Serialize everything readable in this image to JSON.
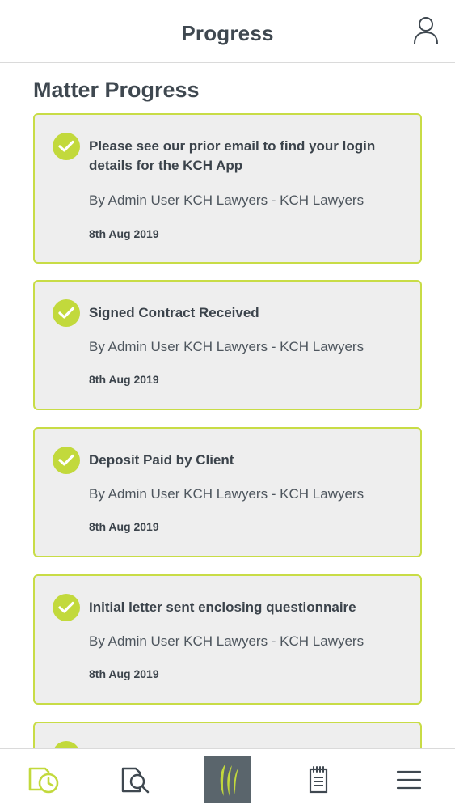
{
  "header": {
    "title": "Progress",
    "profile_icon": "user-icon"
  },
  "main": {
    "section_title": "Matter Progress",
    "items": [
      {
        "title_lines": [
          "Please see our prior email to find your login",
          "details for the KCH App"
        ],
        "author": "By Admin User KCH Lawyers - KCH Lawyers",
        "date": "8th Aug 2019",
        "status_icon": "check-circle-icon"
      },
      {
        "title_lines": [
          "Signed Contract Received"
        ],
        "author": "By Admin User KCH Lawyers - KCH Lawyers",
        "date": "8th Aug 2019",
        "status_icon": "check-circle-icon"
      },
      {
        "title_lines": [
          "Deposit Paid by Client"
        ],
        "author": "By Admin User KCH Lawyers - KCH Lawyers",
        "date": "8th Aug 2019",
        "status_icon": "check-circle-icon"
      },
      {
        "title_lines": [
          "Initial letter sent enclosing questionnaire"
        ],
        "author": "By Admin User KCH Lawyers - KCH Lawyers",
        "date": "8th Aug 2019",
        "status_icon": "check-circle-icon"
      }
    ]
  },
  "bottom_nav": {
    "items": [
      {
        "icon": "progress-clock-icon",
        "active": true
      },
      {
        "icon": "document-search-icon",
        "active": false
      },
      {
        "icon": "kch-logo-icon",
        "active": false
      },
      {
        "icon": "notepad-icon",
        "active": false
      },
      {
        "icon": "menu-icon",
        "active": false
      }
    ]
  },
  "colors": {
    "accent": "#c2d93c",
    "card_border": "#c8dc46",
    "card_bg": "#eeeeee",
    "text": "#3f4850",
    "nav_center_bg": "#5a656c"
  }
}
